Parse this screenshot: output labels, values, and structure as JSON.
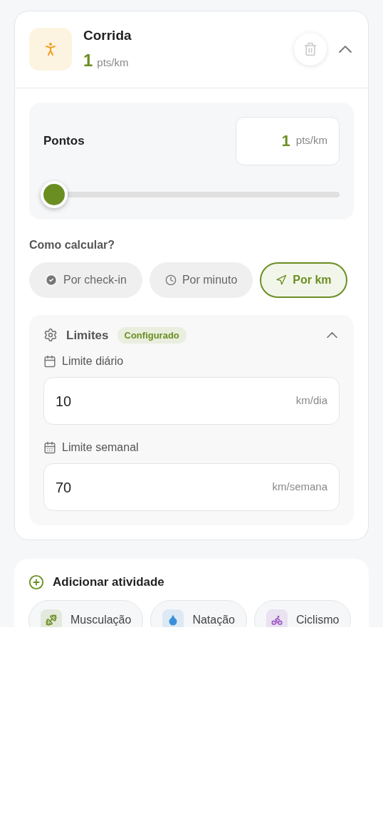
{
  "activity": {
    "name": "Corrida",
    "points": "1",
    "unit": "pts/km",
    "expanded": true
  },
  "points_panel": {
    "label": "Pontos",
    "value": "1",
    "unit": "pts/km",
    "level": 0
  },
  "calc": {
    "label": "Como calcular?",
    "options": [
      {
        "kind": "checkin",
        "label": "Por check-in",
        "selected": false
      },
      {
        "kind": "minute",
        "label": "Por minuto",
        "selected": false
      },
      {
        "kind": "km",
        "label": "Por km",
        "selected": true
      }
    ]
  },
  "limits": {
    "title": "Limites",
    "badge": "Configurado",
    "expanded": true,
    "fields": [
      {
        "kind": "daily",
        "label": "Limite diário",
        "value": "10",
        "unit": "km/dia"
      },
      {
        "kind": "weekly",
        "label": "Limite semanal",
        "value": "70",
        "unit": "km/semana"
      }
    ]
  },
  "add_activity": {
    "title": "Adicionar atividade",
    "options": [
      {
        "kind": "gym",
        "label": "Musculação",
        "color": "#6b8e23"
      },
      {
        "kind": "swim",
        "label": "Natação",
        "color": "#3b8fd9"
      },
      {
        "kind": "bike",
        "label": "Ciclismo",
        "color": "#9b59c6"
      }
    ]
  }
}
